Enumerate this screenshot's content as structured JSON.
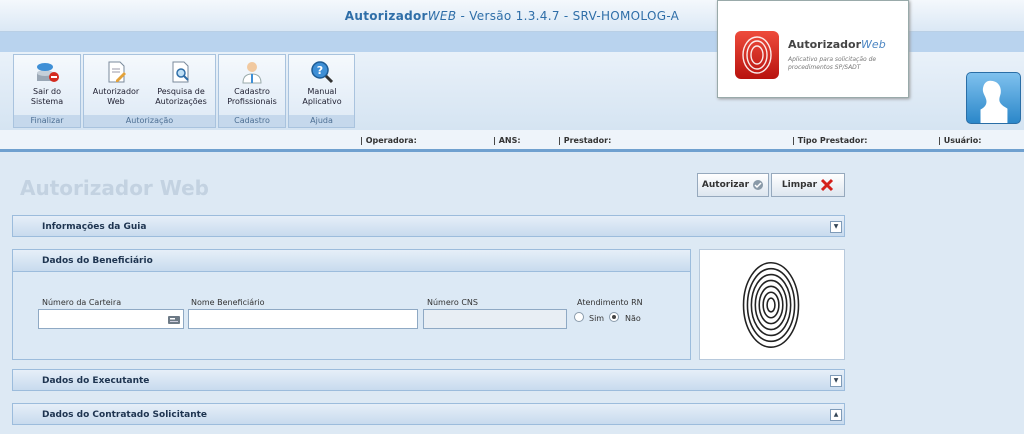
{
  "app": {
    "title_bold": "Autorizador",
    "title_italic": "WEB",
    "title_rest": " - Versão 1.3.4.7 - SRV-HOMOLOG-A"
  },
  "ribbon": {
    "groups": [
      {
        "name": "Finalizar",
        "buttons": [
          "Sair do\nSistema"
        ]
      },
      {
        "name": "Autorização",
        "buttons": [
          "Autorizador\nWeb",
          "Pesquisa de\nAutorizações"
        ]
      },
      {
        "name": "Cadastro",
        "buttons": [
          "Cadastro\nProfissionais"
        ]
      },
      {
        "name": "Ajuda",
        "buttons": [
          "Manual\nAplicativo"
        ]
      }
    ]
  },
  "infobar": {
    "operadora": "| Operadora:",
    "ans": "| ANS:",
    "prestador": "| Prestador:",
    "tipo_prestador": "| Tipo Prestador:",
    "usuario": "| Usuário:"
  },
  "badge": {
    "title": "Autorizador",
    "title_italic": "Web",
    "subtitle": "Aplicativo para solicitação de procedimentos SP/SADT"
  },
  "page": {
    "title": "Autorizador Web"
  },
  "actions": {
    "autorizar": "Autorizar",
    "limpar": "Limpar"
  },
  "sections": {
    "info_guia": "Informações da Guia",
    "beneficiario": "Dados do Beneficiário",
    "executante": "Dados do Executante",
    "contratado": "Dados do Contratado Solicitante"
  },
  "beneficiario": {
    "carteira_label": "Número da Carteira",
    "carteira_value": "",
    "nome_label": "Nome Beneficiário",
    "nome_value": "",
    "cns_label": "Número CNS",
    "cns_value": "",
    "rn_label": "Atendimento RN",
    "rn_sim": "Sim",
    "rn_nao": "Não",
    "rn_selected": "Não"
  },
  "colors": {
    "accent": "#2f6ea8",
    "brand_red": "#d4201a",
    "background": "#dde9f4"
  }
}
